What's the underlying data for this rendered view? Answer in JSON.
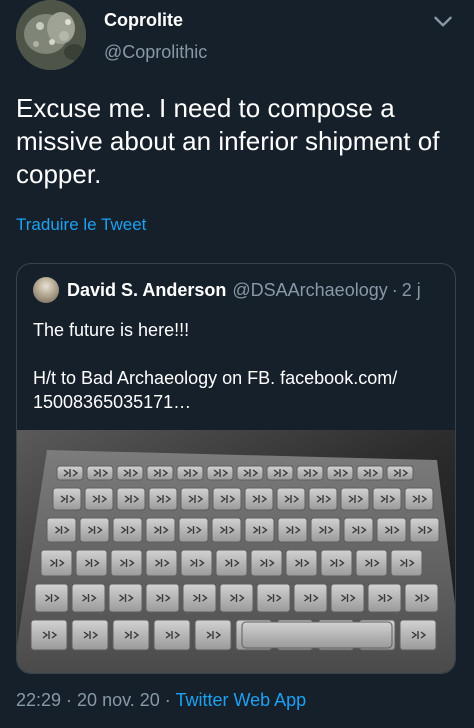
{
  "author": {
    "name": "Coprolite",
    "handle": "@Coprolithic"
  },
  "tweet": {
    "text": "Excuse me. I need to compose a missive about an inferior shipment of copper.",
    "translate_label": "Traduire le Tweet"
  },
  "quoted": {
    "name": "David S. Anderson",
    "handle": "@DSAArchaeology",
    "separator": "·",
    "time": "2 j",
    "text_line1": "The future is here!!!",
    "text_line2": "H/t to Bad Archaeology on FB. facebook.com/\n15008365035171…"
  },
  "footer": {
    "time": "22:29",
    "sep1": " · ",
    "date": "20 nov. 20",
    "sep2": " · ",
    "app": "Twitter Web App"
  },
  "colors": {
    "background": "#15202b",
    "link": "#1da1f2",
    "secondary_text": "#8899a6",
    "border": "#38444d"
  },
  "icons": {
    "more": "chevron-down-icon"
  }
}
